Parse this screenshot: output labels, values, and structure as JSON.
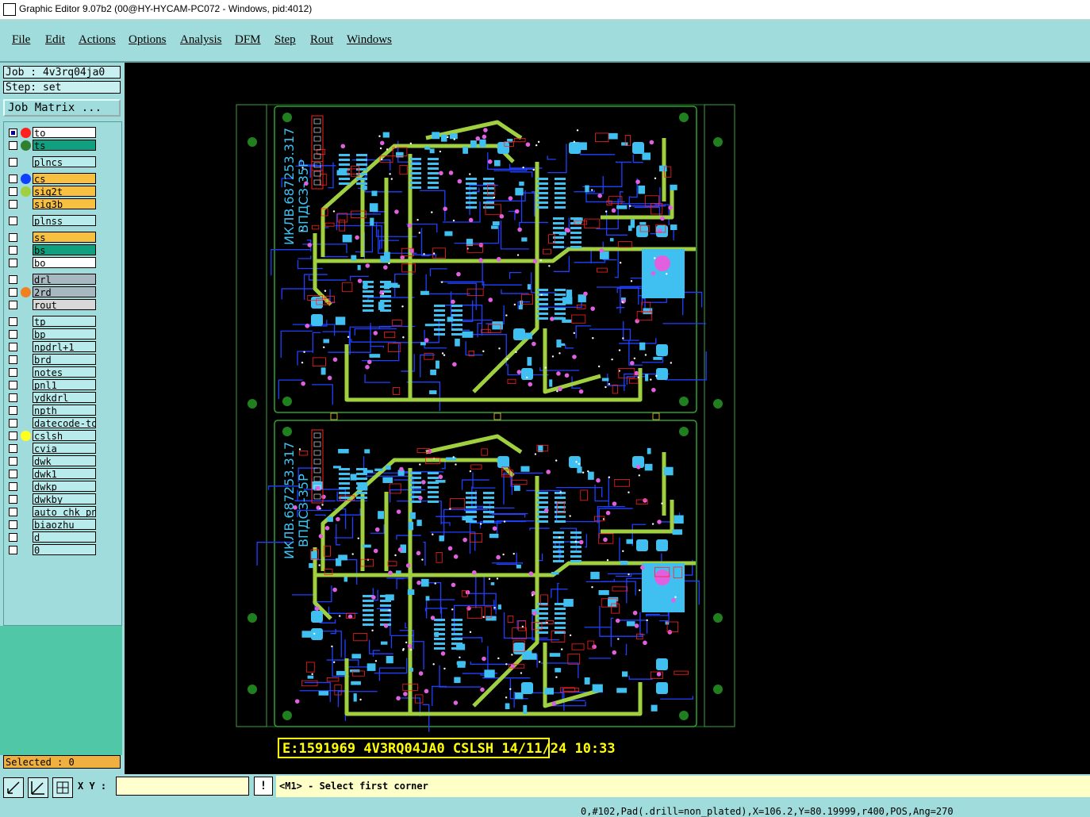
{
  "window": {
    "title": "Graphic Editor 9.07b2 (00@HY-HYCAM-PC072 - Windows, pid:4012)"
  },
  "menu": [
    "File",
    "Edit",
    "Actions",
    "Options",
    "Analysis",
    "DFM",
    "Step",
    "Rout",
    "Windows"
  ],
  "panel": {
    "job": "Job : 4v3rq04ja0",
    "step": "Step: set",
    "job_matrix": "Job Matrix ...",
    "selected": "Selected : 0"
  },
  "layers": [
    {
      "name": "to",
      "color": "#ffffff",
      "dot": "#ff2020",
      "checked": true
    },
    {
      "name": "ts",
      "color": "#10a080",
      "dot": "#308030",
      "checked": false
    },
    {
      "name": "plncs",
      "color": "#b8ecec",
      "dot": "",
      "checked": false
    },
    {
      "name": "cs",
      "color": "#f8c040",
      "dot": "#1040ff",
      "checked": false
    },
    {
      "name": "sig2t",
      "color": "#f8c040",
      "dot": "#a0d040",
      "checked": false
    },
    {
      "name": "sig3b",
      "color": "#f8c040",
      "dot": "",
      "checked": false
    },
    {
      "name": "plnss",
      "color": "#b8ecec",
      "dot": "",
      "checked": false
    },
    {
      "name": "ss",
      "color": "#f8c040",
      "dot": "",
      "checked": false
    },
    {
      "name": "bs",
      "color": "#10a080",
      "dot": "",
      "checked": false
    },
    {
      "name": "bo",
      "color": "#ffffff",
      "dot": "",
      "checked": false
    },
    {
      "name": "drl",
      "color": "#a8b8c0",
      "dot": "",
      "checked": false
    },
    {
      "name": "2rd",
      "color": "#a8b8c0",
      "dot": "#f08020",
      "checked": false
    },
    {
      "name": "rout",
      "color": "#d8d8d8",
      "dot": "",
      "checked": false
    },
    {
      "name": "tp",
      "color": "#b8ecec",
      "dot": "",
      "checked": false
    },
    {
      "name": "bp",
      "color": "#b8ecec",
      "dot": "",
      "checked": false
    },
    {
      "name": "npdrl+1",
      "color": "#b8ecec",
      "dot": "",
      "checked": false
    },
    {
      "name": "brd",
      "color": "#b8ecec",
      "dot": "",
      "checked": false
    },
    {
      "name": "notes",
      "color": "#b8ecec",
      "dot": "",
      "checked": false
    },
    {
      "name": "pnl1",
      "color": "#b8ecec",
      "dot": "",
      "checked": false
    },
    {
      "name": "ydkdrl",
      "color": "#b8ecec",
      "dot": "",
      "checked": false
    },
    {
      "name": "npth",
      "color": "#b8ecec",
      "dot": "",
      "checked": false
    },
    {
      "name": "datecode-to",
      "color": "#b8ecec",
      "dot": "",
      "checked": false
    },
    {
      "name": "cslsh",
      "color": "#b8ecec",
      "dot": "#ffff20",
      "checked": false
    },
    {
      "name": "cvia",
      "color": "#b8ecec",
      "dot": "",
      "checked": false
    },
    {
      "name": "dwk",
      "color": "#b8ecec",
      "dot": "",
      "checked": false
    },
    {
      "name": "dwk1",
      "color": "#b8ecec",
      "dot": "",
      "checked": false
    },
    {
      "name": "dwkp",
      "color": "#b8ecec",
      "dot": "",
      "checked": false
    },
    {
      "name": "dwkby",
      "color": "#b8ecec",
      "dot": "",
      "checked": false
    },
    {
      "name": "auto_chk_pn.",
      "color": "#b8ecec",
      "dot": "",
      "checked": false
    },
    {
      "name": "biaozhu",
      "color": "#b8ecec",
      "dot": "",
      "checked": false
    },
    {
      "name": "d",
      "color": "#b8ecec",
      "dot": "",
      "checked": false
    },
    {
      "name": "0",
      "color": "#b8ecec",
      "dot": "",
      "checked": false
    }
  ],
  "canvas": {
    "board_label_1": "ИКЛВ.687253.317",
    "board_label_2": "ВПДСЗ-35Р",
    "stamp": "E:1591969 4V3RQ04JA0 CSLSH 14/11/24 10:33"
  },
  "bottom": {
    "xy_label": "X Y :",
    "xy_value": "",
    "prompt": "<M1> - Select first corner",
    "status": "0,#102,Pad(.drill=non_plated),X=106.2,Y=80.19999,r400,POS,Ang=270"
  },
  "colors": {
    "bg": "#a0dcdc",
    "trace": "#a0d040",
    "copper": "#2040ff",
    "pad": "#40c0f0",
    "silk": "#ff2020",
    "via": "#e060e0"
  }
}
